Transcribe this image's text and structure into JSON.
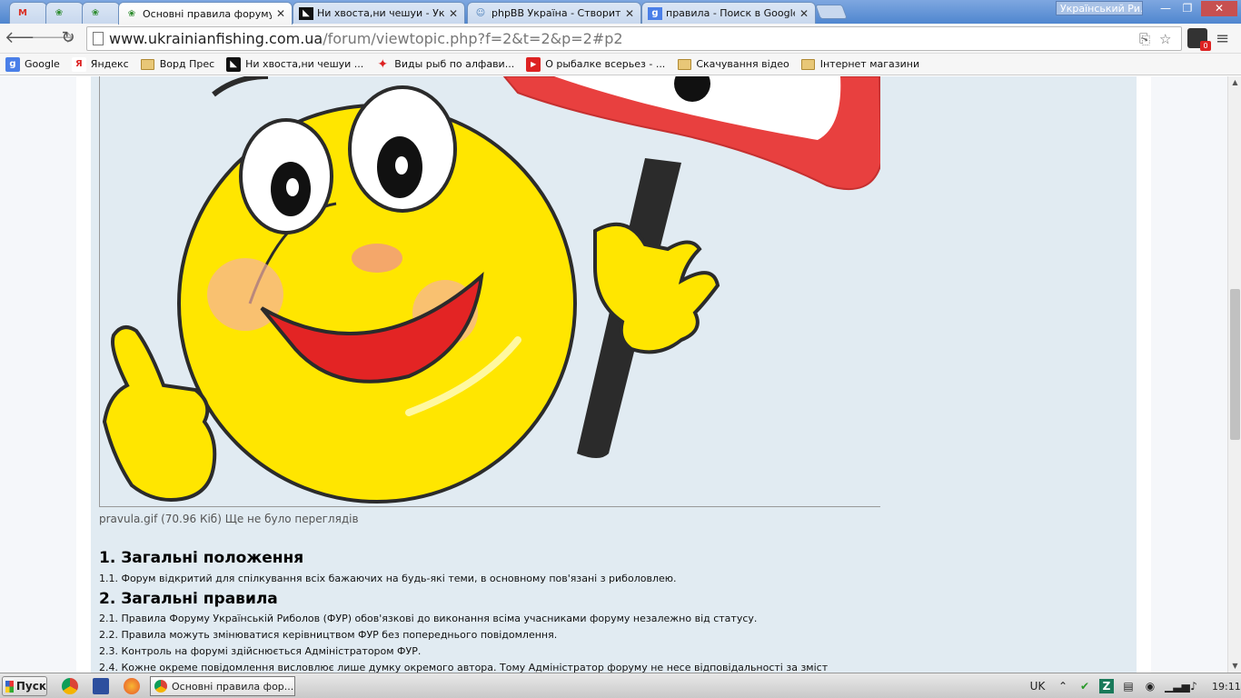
{
  "tabs": [
    {
      "title": "",
      "favicon": "gmail-icon",
      "active": false
    },
    {
      "title": "",
      "favicon": "forum-icon",
      "active": false
    },
    {
      "title": "",
      "favicon": "forum-icon",
      "active": false
    },
    {
      "title": "Основні правила форуму \"У",
      "favicon": "forum-icon",
      "active": true
    },
    {
      "title": "Ни хвоста,ни чешуи - Украї",
      "favicon": "fish-site-icon",
      "active": false
    },
    {
      "title": "phpBB Україна - Створити п",
      "favicon": "phpbb-icon",
      "active": false
    },
    {
      "title": "правила - Поиск в Google",
      "favicon": "google-icon",
      "active": false
    }
  ],
  "window": {
    "profile_label": "Український Ри...",
    "minimize": "—",
    "restore": "❐",
    "close": "✕"
  },
  "toolbar": {
    "url_host": "www.ukrainianfishing.com.ua",
    "url_path": "/forum/viewtopic.php?f=2&t=2&p=2#p2",
    "ext_badge": "0"
  },
  "bookmarks": [
    {
      "label": "Google",
      "icon": "google-icon"
    },
    {
      "label": "Яндекс",
      "icon": "yandex-icon"
    },
    {
      "label": "Ворд Прес",
      "icon": "folder-icon"
    },
    {
      "label": "Ни хвоста,ни чешуи ...",
      "icon": "fish-site-icon"
    },
    {
      "label": "Виды рыб по алфави...",
      "icon": "fish-icon"
    },
    {
      "label": "О рыбалке всерьез - ...",
      "icon": "youtube-icon"
    },
    {
      "label": "Скачування відео",
      "icon": "folder-icon"
    },
    {
      "label": "Інтернет магазини",
      "icon": "folder-icon"
    }
  ],
  "post": {
    "attachment_caption": "pravula.gif (70.96 Кіб) Ще не було переглядів",
    "section1_title": "1. Загальні положення",
    "section1_rules": [
      "1.1. Форум відкритий для спілкування всіх бажаючих на будь-які теми, в основному пов'язані з риболовлею."
    ],
    "section2_title": "2. Загальні правила",
    "section2_rules": [
      "2.1. Правила Форуму Українській Риболов (ФУР) обов'язкові до виконання всіма учасниками форуму незалежно від статусу.",
      "2.2. Правила можуть змінюватися керівництвом ФУР без попереднього повідомлення.",
      "2.3. Контроль на форумі здійснюється Адміністратором ФУР.",
      "2.4. Кожне окреме повідомлення висловлює лише думку окремого автора. Тому Адміністратор форуму не несе відповідальності за зміст"
    ]
  },
  "taskbar": {
    "start_label": "Пуск",
    "task_title": "Основні правила фор...",
    "lang": "UK",
    "clock": "19:11"
  },
  "colors": {
    "post_bg": "#e1ebf2",
    "smiley_yellow": "#ffe600",
    "sign_red": "#e8403f"
  }
}
